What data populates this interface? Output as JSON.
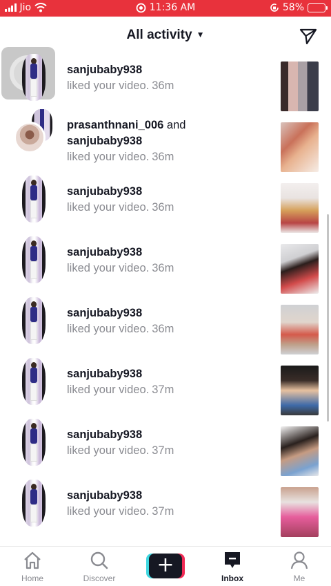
{
  "status_bar": {
    "carrier": "Jio",
    "time": "11:36 AM",
    "battery": "58%",
    "battery_level_fraction": 0.58,
    "icons": [
      "signal-icon",
      "wifi-icon",
      "alarm-icon",
      "orientation-lock-icon",
      "battery-icon"
    ]
  },
  "header": {
    "title": "All activity",
    "dropdown_icon": "caret-down-icon",
    "send_icon": "send-icon"
  },
  "activities": [
    {
      "user": "sanjubaby938",
      "action": "liked your video.",
      "time": "36m"
    },
    {
      "user": "prasanthnani_006",
      "joiner": "and",
      "user2": "sanjubaby938",
      "action": "liked your video.",
      "time": "36m"
    },
    {
      "user": "sanjubaby938",
      "action": "liked your video.",
      "time": "36m"
    },
    {
      "user": "sanjubaby938",
      "action": "liked your video.",
      "time": "36m"
    },
    {
      "user": "sanjubaby938",
      "action": "liked your video.",
      "time": "36m"
    },
    {
      "user": "sanjubaby938",
      "action": "liked your video.",
      "time": "37m"
    },
    {
      "user": "sanjubaby938",
      "action": "liked your video.",
      "time": "37m"
    },
    {
      "user": "sanjubaby938",
      "action": "liked your video.",
      "time": "37m"
    }
  ],
  "tabbar": {
    "home": "Home",
    "discover": "Discover",
    "create_icon": "plus-icon",
    "inbox": "Inbox",
    "me": "Me",
    "active": "Inbox"
  },
  "colors": {
    "status_bar_bg": "#e8323c",
    "text_primary": "#161823",
    "text_secondary": "#8a8b91",
    "create_cyan": "#3fd7e0",
    "create_pink": "#f12a55"
  }
}
